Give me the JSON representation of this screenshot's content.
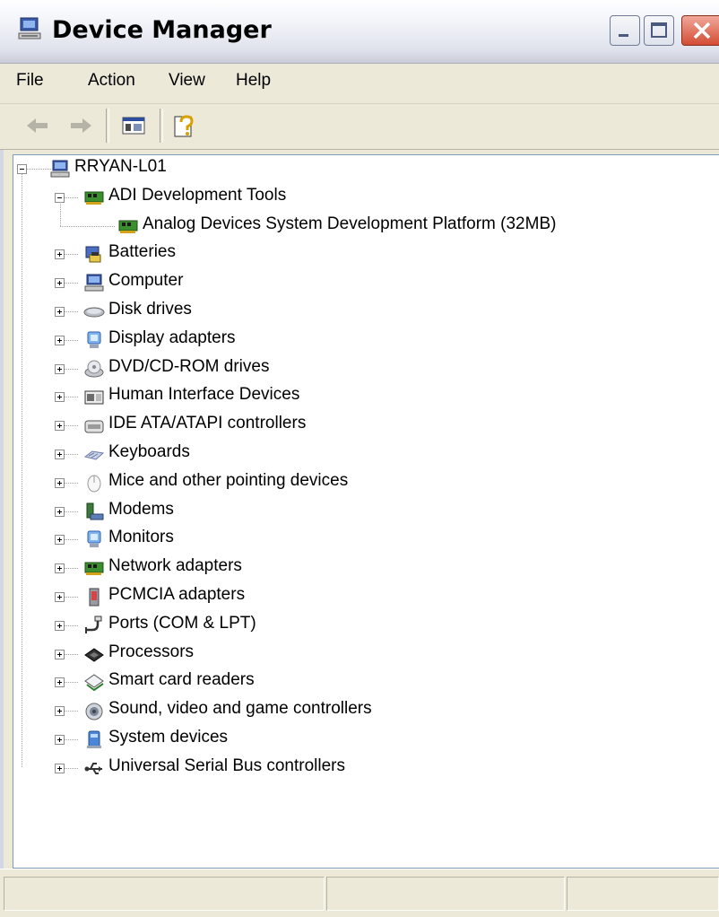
{
  "window": {
    "title": "Device Manager"
  },
  "menu": {
    "file": "File",
    "action": "Action",
    "view": "View",
    "help": "Help"
  },
  "toolbar": {
    "back_icon": "arrow-left-icon",
    "forward_icon": "arrow-right-icon",
    "show_hide_tree_icon": "console-tree-icon",
    "help_icon": "help-icon"
  },
  "tree": {
    "root": {
      "label": "RRYAN-L01",
      "icon": "computer-icon"
    },
    "categories": [
      {
        "label": "ADI Development Tools",
        "icon": "network-card-icon",
        "expanded": true,
        "children": [
          {
            "label": "Analog Devices System Development Platform (32MB)",
            "icon": "network-card-icon"
          }
        ]
      },
      {
        "label": "Batteries",
        "icon": "battery-icon"
      },
      {
        "label": "Computer",
        "icon": "computer-icon"
      },
      {
        "label": "Disk drives",
        "icon": "disk-drive-icon"
      },
      {
        "label": "Display adapters",
        "icon": "display-adapter-icon"
      },
      {
        "label": "DVD/CD-ROM drives",
        "icon": "cdrom-icon"
      },
      {
        "label": "Human Interface Devices",
        "icon": "hid-icon"
      },
      {
        "label": "IDE ATA/ATAPI controllers",
        "icon": "ide-controller-icon"
      },
      {
        "label": "Keyboards",
        "icon": "keyboard-icon"
      },
      {
        "label": "Mice and other pointing devices",
        "icon": "mouse-icon"
      },
      {
        "label": "Modems",
        "icon": "modem-icon"
      },
      {
        "label": "Monitors",
        "icon": "monitor-icon"
      },
      {
        "label": "Network adapters",
        "icon": "network-card-icon"
      },
      {
        "label": "PCMCIA adapters",
        "icon": "pcmcia-icon"
      },
      {
        "label": "Ports (COM & LPT)",
        "icon": "port-icon"
      },
      {
        "label": "Processors",
        "icon": "processor-icon"
      },
      {
        "label": "Smart card readers",
        "icon": "smart-card-icon"
      },
      {
        "label": "Sound, video and game controllers",
        "icon": "speaker-icon"
      },
      {
        "label": "System devices",
        "icon": "system-device-icon"
      },
      {
        "label": "Universal Serial Bus controllers",
        "icon": "usb-icon"
      }
    ]
  },
  "colors": {
    "chrome": "#ece9d8",
    "tree_background": "#ffffff",
    "tree_border": "#7f9db9",
    "close_button": "#d44c33"
  }
}
